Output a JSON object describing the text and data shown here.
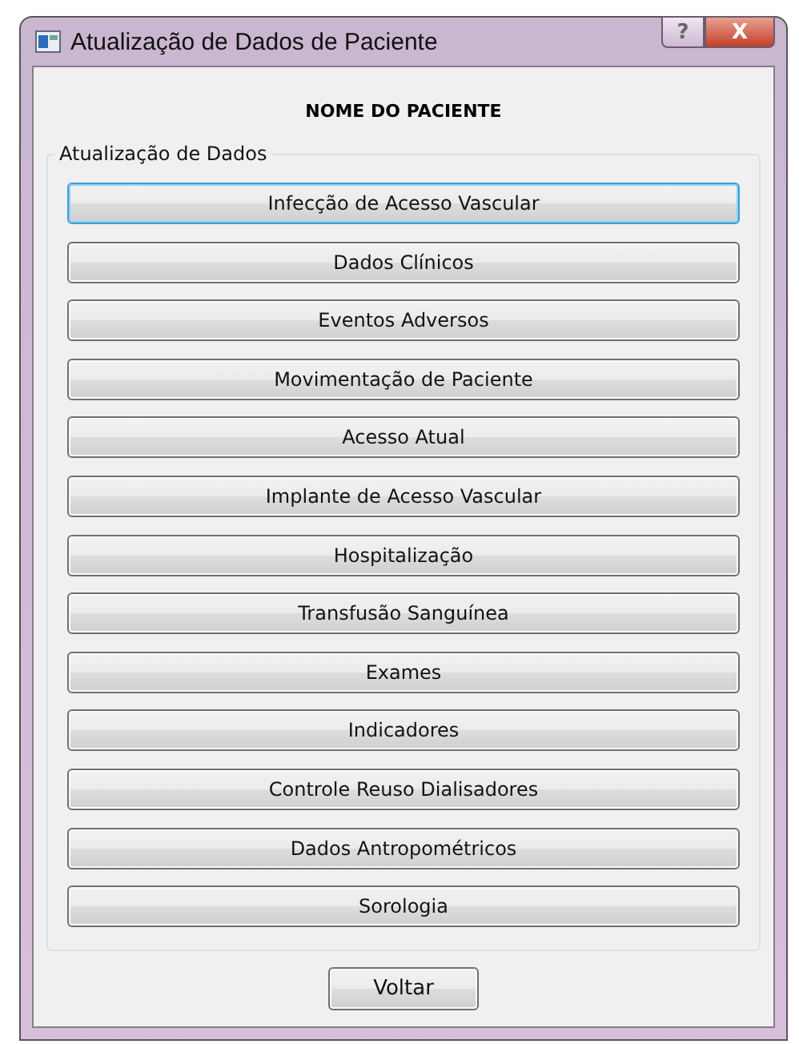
{
  "window": {
    "title": "Atualização de Dados de Paciente",
    "help_button": "?",
    "close_button": "X"
  },
  "patient_name": "NOME DO PACIENTE",
  "group": {
    "title": "Atualização de Dados",
    "buttons": [
      {
        "label": "Infecção de Acesso Vascular",
        "focused": true
      },
      {
        "label": "Dados Clínicos",
        "focused": false
      },
      {
        "label": "Eventos Adversos",
        "focused": false
      },
      {
        "label": "Movimentação de Paciente",
        "focused": false
      },
      {
        "label": "Acesso Atual",
        "focused": false
      },
      {
        "label": "Implante de Acesso Vascular",
        "focused": false
      },
      {
        "label": "Hospitalização",
        "focused": false
      },
      {
        "label": "Transfusão Sanguínea",
        "focused": false
      },
      {
        "label": "Exames",
        "focused": false
      },
      {
        "label": "Indicadores",
        "focused": false
      },
      {
        "label": "Controle Reuso Dialisadores",
        "focused": false
      },
      {
        "label": "Dados Antropométricos",
        "focused": false
      },
      {
        "label": "Sorologia",
        "focused": false
      }
    ]
  },
  "back_button": "Voltar"
}
